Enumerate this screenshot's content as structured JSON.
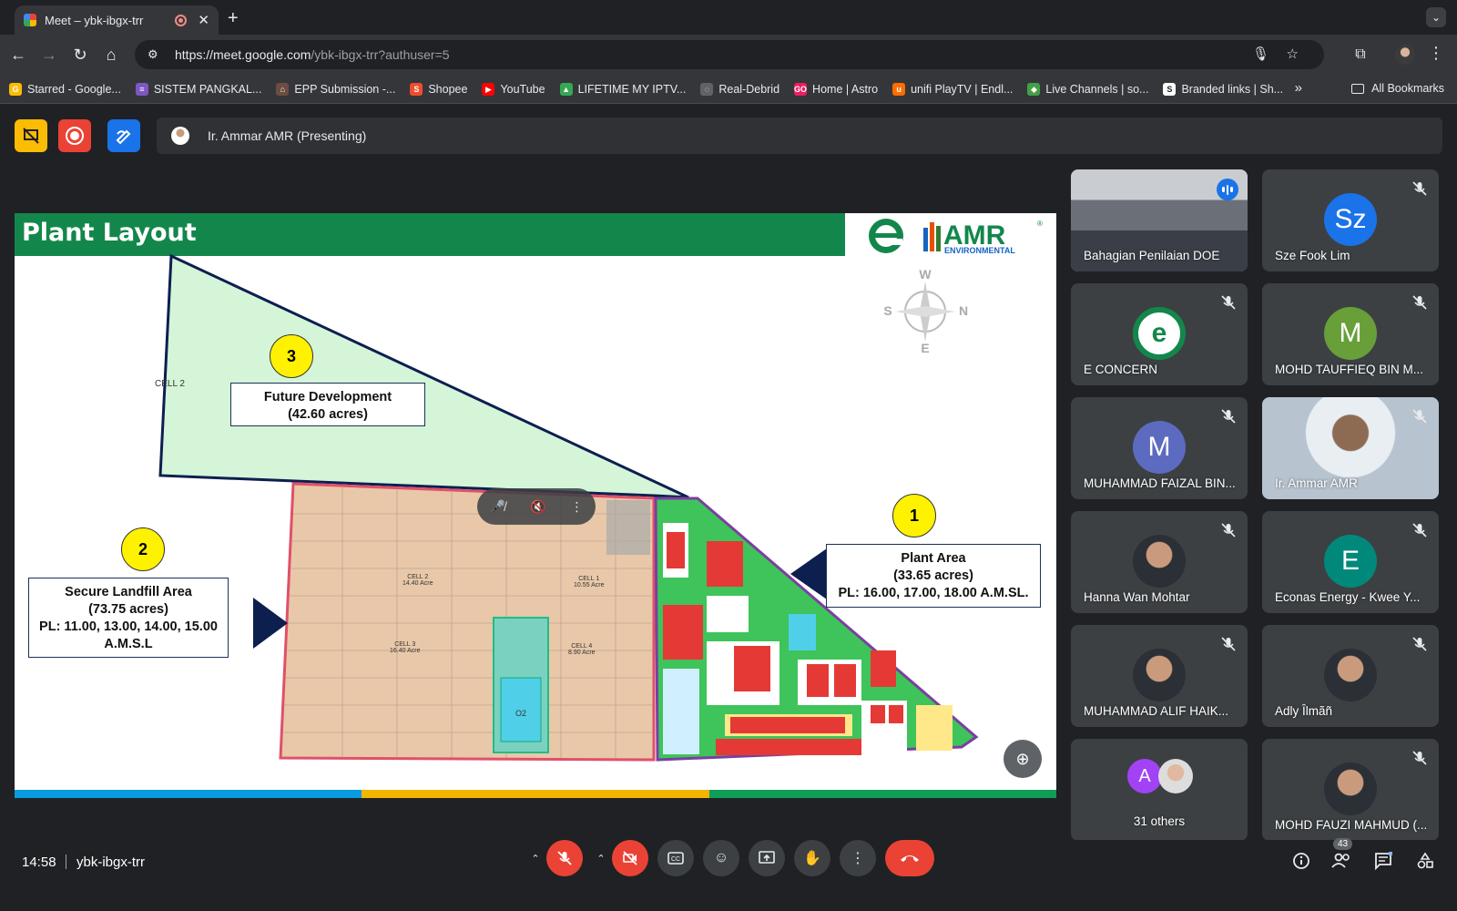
{
  "browser": {
    "tab_title": "Meet – ybk-ibgx-trr",
    "new_tab": "+",
    "close": "✕",
    "url_host": "https://meet.google.com",
    "url_rest": "/ybk-ibgx-trr?authuser=5",
    "bookmarks": [
      {
        "label": "Starred - Google...",
        "color": "#fbbc04",
        "icon": "G"
      },
      {
        "label": "SISTEM PANGKAL...",
        "color": "#7e57c2",
        "icon": "≡"
      },
      {
        "label": "EPP Submission -...",
        "color": "#6d4c41",
        "icon": "⌂"
      },
      {
        "label": "Shopee",
        "color": "#ee4d2d",
        "icon": "S"
      },
      {
        "label": "YouTube",
        "color": "#ff0000",
        "icon": "▶"
      },
      {
        "label": "LIFETIME MY IPTV...",
        "color": "#34a853",
        "icon": "▲"
      },
      {
        "label": "Real-Debrid",
        "color": "#5f6368",
        "icon": "◌"
      },
      {
        "label": "Home | Astro",
        "color": "#e91e63",
        "icon": "GO"
      },
      {
        "label": "unifi PlayTV | Endl...",
        "color": "#ff6d00",
        "icon": "u"
      },
      {
        "label": "Live Channels | so...",
        "color": "#43a047",
        "icon": "◆"
      },
      {
        "label": "Branded links | Sh...",
        "color": "#ffffff",
        "icon": "S"
      }
    ],
    "more": "»",
    "all_bookmarks": "All Bookmarks"
  },
  "meet": {
    "presenting_label": "Ir. Ammar AMR (Presenting)",
    "time": "14:58",
    "meeting_code": "ybk-ibgx-trr",
    "people_count": "43"
  },
  "slide": {
    "title": "Plant Layout",
    "brand_name": "AMR",
    "brand_sub": "ENVIRONMENTAL",
    "brand_reg": "®",
    "compass": {
      "w": "W",
      "e": "E",
      "n": "N",
      "s": "S"
    },
    "areas": [
      {
        "num": "3",
        "line1": "Future Development",
        "line2": "(42.60 acres)"
      },
      {
        "num": "2",
        "line1": "Secure Landfill Area",
        "line2": "(73.75 acres)",
        "line3": "PL: 11.00, 13.00, 14.00, 15.00",
        "line4": "A.M.S.L"
      },
      {
        "num": "1",
        "line1": "Plant Area",
        "line2": "(33.65 acres)",
        "line3": "PL: 16.00, 17.00, 18.00 A.M.SL."
      }
    ],
    "cells": [
      {
        "name": "CELL 2",
        "size": "14.40 Acre"
      },
      {
        "name": "CELL 1",
        "size": "10.55 Acre"
      },
      {
        "name": "CELL 3",
        "size": "16.40 Acre"
      },
      {
        "name": "CELL 4",
        "size": "8.90 Acre"
      }
    ],
    "pond_label": "O2"
  },
  "participants": [
    {
      "name": "Bahagian Penilaian DOE",
      "type": "video",
      "speaking": true
    },
    {
      "name": "Sze Fook Lim",
      "initials": "Sz",
      "color": "#1a73e8",
      "muted": true
    },
    {
      "name": "E CONCERN",
      "type": "logo",
      "muted": true
    },
    {
      "name": "MOHD TAUFFIEQ BIN M...",
      "initials": "M",
      "color": "#689f38",
      "muted": true
    },
    {
      "name": "MUHAMMAD FAIZAL BIN...",
      "initials": "M",
      "color": "#5c6bc0",
      "muted": true
    },
    {
      "name": "Ir. Ammar AMR",
      "type": "video2",
      "muted": true
    },
    {
      "name": "Hanna Wan Mohtar",
      "type": "photo",
      "muted": true
    },
    {
      "name": "Econas Energy - Kwee Y...",
      "initials": "E",
      "color": "#00897b",
      "muted": true
    },
    {
      "name": "MUHAMMAD ALIF HAIK...",
      "type": "photo",
      "muted": true
    },
    {
      "name": "Adly Îlmãñ",
      "type": "photo",
      "muted": true
    },
    {
      "name": "31 others",
      "type": "others",
      "initials": "A",
      "color": "#a142f4"
    },
    {
      "name": "MOHD FAUZI MAHMUD (...",
      "type": "photo",
      "muted": true
    }
  ],
  "colors": {
    "slide_green": "#13874b",
    "footer": [
      "#0a9ae0",
      "#f4b400",
      "#0f9d58"
    ],
    "future": "#d4f5d8",
    "landfill": "#e8c8a8",
    "plant": "#3ec45a",
    "navy": "#0d1f4f"
  }
}
